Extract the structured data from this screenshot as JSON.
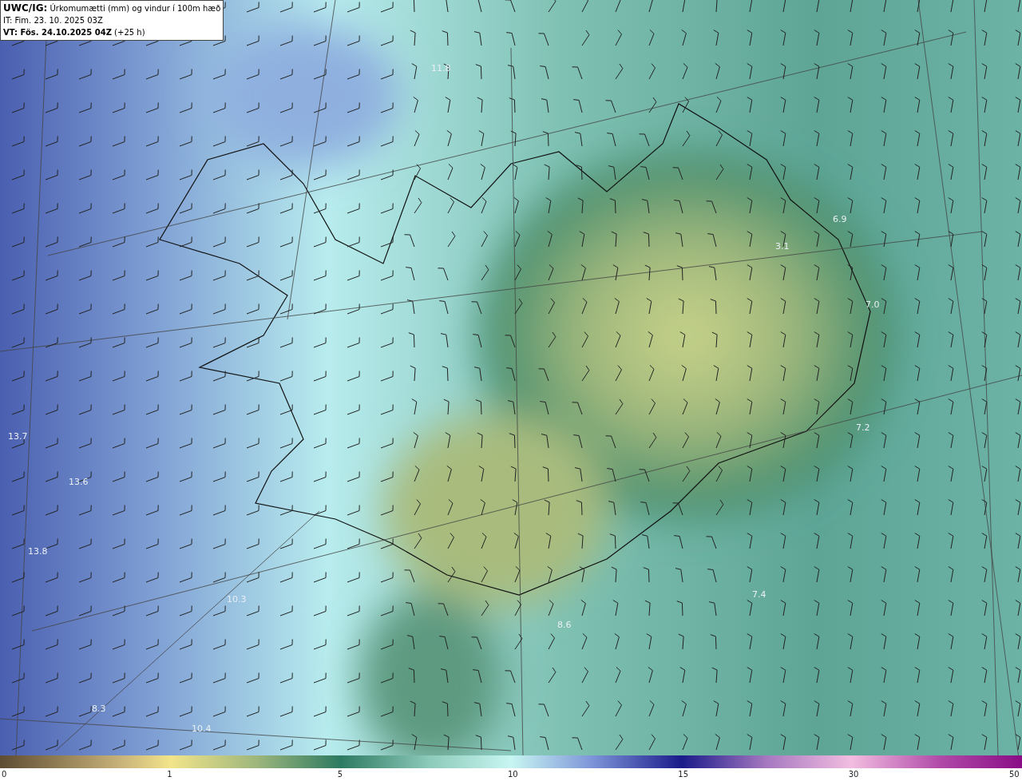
{
  "header": {
    "title": "**UWC/IG:** Úrkomumætti (mm) og vindur í 100m hæð",
    "issue_time": "IT: Fim. 23. 10. 2025 03Z",
    "valid_time": "**VT: Fös. 24.10.2025 04Z** (+25 h)"
  },
  "map_values": [
    "11.8",
    "6.9",
    "3.1",
    "7.0",
    "7.2",
    "13.7",
    "13.6",
    "13.8",
    "10.3",
    "7.4",
    "8.6",
    "8.3",
    "10.4"
  ],
  "colorbar": {
    "ticks": [
      "0",
      "1",
      "5",
      "10",
      "15",
      "30",
      "50"
    ]
  }
}
